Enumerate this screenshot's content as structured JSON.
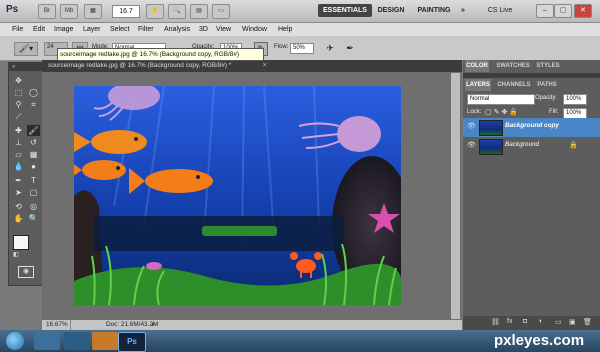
{
  "app": {
    "logo": "Ps",
    "zoom": "16.7",
    "br": "Br",
    "mb": "Mb"
  },
  "workspaces": {
    "essentials": "ESSENTIALS",
    "design": "DESIGN",
    "painting": "PAINTING",
    "more": "»",
    "cslive": "CS Live"
  },
  "menu": [
    "File",
    "Edit",
    "Image",
    "Layer",
    "Select",
    "Filter",
    "Analysis",
    "3D",
    "View",
    "Window",
    "Help"
  ],
  "options": {
    "size": "24",
    "mode_label": "Mode:",
    "mode_value": "Normal",
    "opacity_label": "Opacity:",
    "opacity_value": "100%",
    "flow_label": "Flow:",
    "flow_value": "50%"
  },
  "tooltip": "sourceimage redlake.jpg @ 16.7% (Background copy, RGB/8#)",
  "document": {
    "tab_title": "sourceimage redlake.jpg @ 16.7% (Background copy, RGB/8#) *",
    "zoom_status": "16.67%",
    "doc_size": "Doc: 21.6M/43.2M"
  },
  "panels": {
    "top_tabs": [
      "COLOR",
      "SWATCHES",
      "STYLES"
    ],
    "layer_tabs": [
      "LAYERS",
      "CHANNELS",
      "PATHS"
    ],
    "blend_mode": "Normal",
    "opacity_label": "Opacity:",
    "opacity_value": "100%",
    "lock_label": "Lock:",
    "fill_label": "Fill:",
    "fill_value": "100%",
    "layers": [
      {
        "name": "Background copy",
        "selected": true
      },
      {
        "name": "Background",
        "selected": false
      }
    ]
  },
  "watermark": "pxleyes.com",
  "colors": {
    "accent": "#4a86c6",
    "ps_dark": "#535353"
  }
}
